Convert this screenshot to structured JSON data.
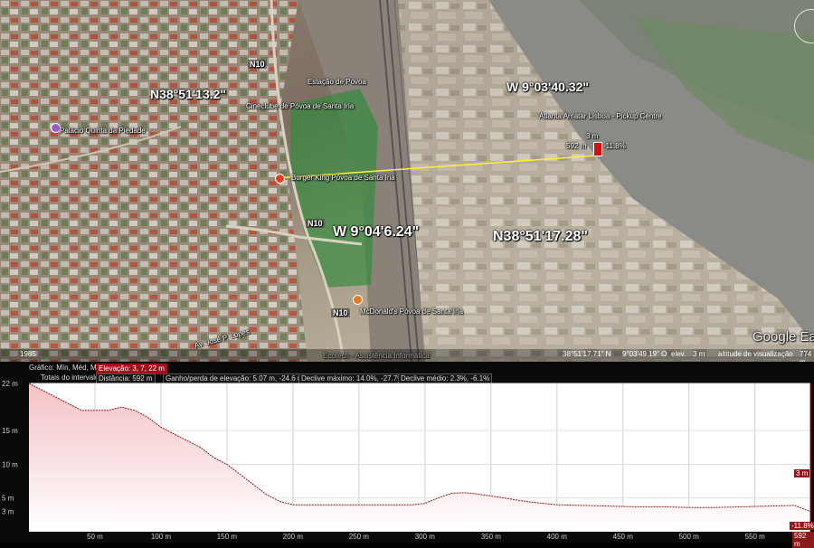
{
  "map": {
    "labels": {
      "w_area": "W  9°04'6.24\"",
      "n_area": "N38°51'17.28\"",
      "n_top": "N38°51'13.2\"",
      "w_top": "W  9°03'40.32\"",
      "burger_king": "Burger King Póvoa de Santa Iria",
      "mcdonalds": "McDonald's Póvoa de Santa Iria",
      "palacio": "Palácio Quinta da Piedade",
      "ecotech": "Ecotech - Assistência Informática",
      "n10_a": "N10",
      "n10_b": "N10",
      "n10_c": "N10",
      "cineclube": "Cineclube de Póvoa de Santa Iria",
      "estacao": "Estação de Póvoa",
      "agency": "Atlanta Amatar Lisboa - Pickup Centre",
      "avenida": "Av. José P. Lopes",
      "marker_dist": "592 m",
      "marker_elev": "3 m",
      "marker_slope": "-11.8%",
      "google": "Google Earth",
      "scale_year": "1985"
    },
    "status": {
      "coords": "38°51'17.71\" N",
      "coords2": "9°03'49.19\" O",
      "elev": "elev.",
      "elev_val": "3 m",
      "eye": "altitude de visualização",
      "eye_val": "774 m"
    }
  },
  "profile": {
    "row1": {
      "grafico": "Gráfico: Mín, Méd, Máx",
      "elevacao": "Elevação: 3, 7, 22 m"
    },
    "row2": {
      "totais": "Totais do intervalo:",
      "distancia": "Distância: 592 m",
      "ganho": "Ganho/perda de elevação: 5.07 m, -24.6 m",
      "declive_max": "Declive máximo: 14.0%, -27.7%",
      "declive_medio": "Declive médio: 2.3%, -6.1%"
    },
    "current_elev": "3 m",
    "current_slope": "-11.8%",
    "current_dist": "592 m"
  },
  "chart_data": {
    "type": "area",
    "x_unit": "m",
    "y_unit": "m",
    "xlim": [
      0,
      592
    ],
    "ylim": [
      0,
      22
    ],
    "xticks": [
      "50 m",
      "100 m",
      "150 m",
      "200 m",
      "250 m",
      "300 m",
      "350 m",
      "400 m",
      "450 m",
      "500 m",
      "550 m"
    ],
    "yticks": [
      "22 m",
      "15 m",
      "10 m",
      "5 m",
      "3 m"
    ],
    "ytick_values": [
      22,
      15,
      10,
      5,
      3
    ],
    "xtick_values": [
      50,
      100,
      150,
      200,
      250,
      300,
      350,
      400,
      450,
      500,
      550
    ],
    "x": [
      0,
      10,
      20,
      30,
      40,
      50,
      60,
      70,
      80,
      90,
      100,
      110,
      120,
      130,
      140,
      150,
      160,
      170,
      180,
      190,
      200,
      210,
      220,
      230,
      240,
      250,
      260,
      270,
      280,
      290,
      300,
      310,
      320,
      330,
      340,
      350,
      360,
      370,
      380,
      390,
      400,
      420,
      440,
      460,
      480,
      500,
      520,
      540,
      560,
      580,
      592
    ],
    "y": [
      22,
      21,
      20,
      19,
      18,
      18,
      18,
      18.5,
      18,
      17,
      15.5,
      14.5,
      13.5,
      12.5,
      11,
      10,
      8.5,
      7,
      5.5,
      4.5,
      4,
      4,
      4,
      4,
      4,
      4,
      4,
      4,
      4,
      4,
      4.2,
      5,
      5.7,
      5.8,
      5.6,
      5.3,
      5,
      4.7,
      4.4,
      4.2,
      4,
      3.9,
      3.8,
      3.7,
      3.7,
      3.6,
      3.6,
      3.7,
      3.8,
      3.9,
      3.0
    ],
    "grid": true,
    "colors": {
      "fill_top": "#f4c2c6",
      "fill_bottom": "#ffffff",
      "line": "#8b1a1a",
      "accent": "#a0101a"
    }
  }
}
